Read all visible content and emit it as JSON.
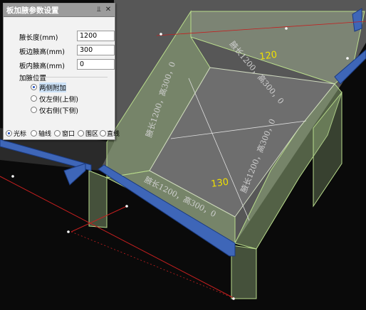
{
  "panel": {
    "title": "板加腋参数设置",
    "pin_icon": "pin-icon",
    "close_icon": "close-icon",
    "fields": [
      {
        "label": "腋长度(mm)",
        "value": "1200"
      },
      {
        "label": "板边腋高(mm)",
        "value": "300"
      },
      {
        "label": "板内腋高(mm)",
        "value": "0"
      }
    ],
    "position_group": {
      "title": "加腋位置",
      "options": [
        {
          "label": "两侧附加",
          "selected": true
        },
        {
          "label": "仅左侧(上侧)",
          "selected": false
        },
        {
          "label": "仅右侧(下侧)",
          "selected": false
        }
      ]
    },
    "mode_options": [
      {
        "label": "光标",
        "selected": true
      },
      {
        "label": "轴线",
        "selected": false
      },
      {
        "label": "窗口",
        "selected": false
      },
      {
        "label": "围区",
        "selected": false
      },
      {
        "label": "直线",
        "selected": false
      }
    ]
  },
  "viewport": {
    "labels": {
      "dim_top": "120",
      "dim_front": "130",
      "haunch_left_back": "腋长1200，高300，0",
      "haunch_left": "腋长1200，高300，0",
      "haunch_front": "腋长1200，高300，0",
      "haunch_right": "腋长1200，高300，0"
    },
    "colors": {
      "background": "#0a0a0a",
      "slab": "#6e6e6e",
      "haunch_fill": "#8fa978",
      "edge": "#b9dc8c",
      "beam": "#3e66b8",
      "axis": "#c41f1f",
      "dim_text": "#f0e000"
    }
  }
}
